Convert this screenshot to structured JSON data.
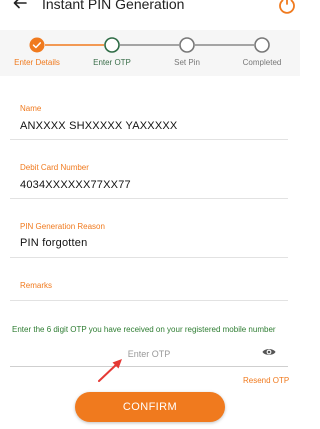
{
  "header": {
    "title": "Instant PIN Generation",
    "back_icon": "back-arrow-icon",
    "power_icon": "power-icon"
  },
  "stepper": {
    "steps": [
      {
        "label": "Enter Details",
        "state": "completed"
      },
      {
        "label": "Enter OTP",
        "state": "current"
      },
      {
        "label": "Set Pin",
        "state": "pending"
      },
      {
        "label": "Completed",
        "state": "pending"
      }
    ]
  },
  "form": {
    "name": {
      "label": "Name",
      "value": "ANXXXX SHXXXXX YAXXXXX"
    },
    "debit_card": {
      "label": "Debit Card Number",
      "value": "4034XXXXXX77XX77"
    },
    "reason": {
      "label": "PIN Generation Reason",
      "value": "PIN forgotten"
    },
    "remarks": {
      "label": "Remarks",
      "value": ""
    }
  },
  "otp": {
    "note": "Enter the 6 digit OTP you have received on your registered mobile number",
    "placeholder": "Enter OTP",
    "value": "",
    "resend_label": "Resend OTP"
  },
  "confirm_label": "CONFIRM",
  "colors": {
    "accent": "#f07a1e",
    "current_step": "#2e6b45",
    "pending_step": "#777777",
    "otp_note": "#2e7d32",
    "arrow": "#e53935"
  }
}
